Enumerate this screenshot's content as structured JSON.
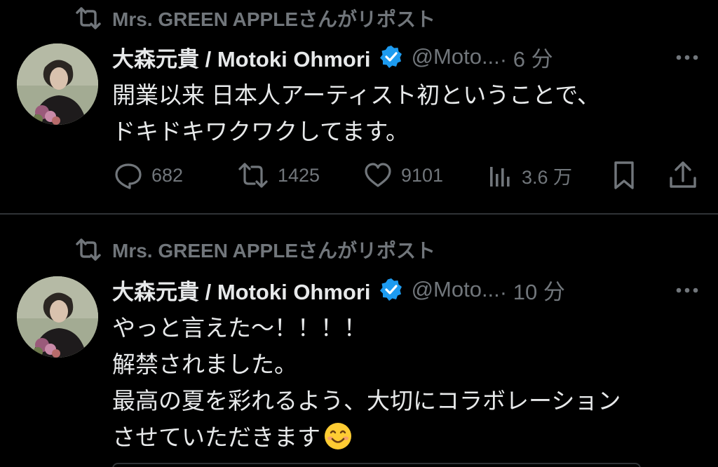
{
  "tweets": [
    {
      "repost_label": "Mrs. GREEN APPLEさんがリポスト",
      "display_name": "大森元貴 / Motoki Ohmori",
      "handle": "@Moto...",
      "time": "· 6 分",
      "lines": [
        "開業以来 日本人アーティスト初ということで、",
        "ドキドキワクワクしてます。"
      ],
      "stats": {
        "replies": "682",
        "reposts": "1425",
        "likes": "9101",
        "views": "3.6 万"
      }
    },
    {
      "repost_label": "Mrs. GREEN APPLEさんがリポスト",
      "display_name": "大森元貴 / Motoki Ohmori",
      "handle": "@Moto...",
      "time": "· 10 分",
      "lines": [
        "やっと言えた〜！！！！",
        "解禁されました。",
        "最高の夏を彩れるよう、大切にコラボレーション",
        "させていただきます"
      ],
      "emoji": "smiling-face-emoji"
    }
  ],
  "colors": {
    "background": "#000000",
    "text": "#e7e9ea",
    "muted": "#71767b",
    "verified": "#1d9bf0",
    "divider": "#2f3336"
  },
  "icons": [
    "repost-icon",
    "verified-badge-icon",
    "more-icon",
    "reply-icon",
    "like-icon",
    "views-icon",
    "bookmark-icon",
    "share-icon"
  ]
}
